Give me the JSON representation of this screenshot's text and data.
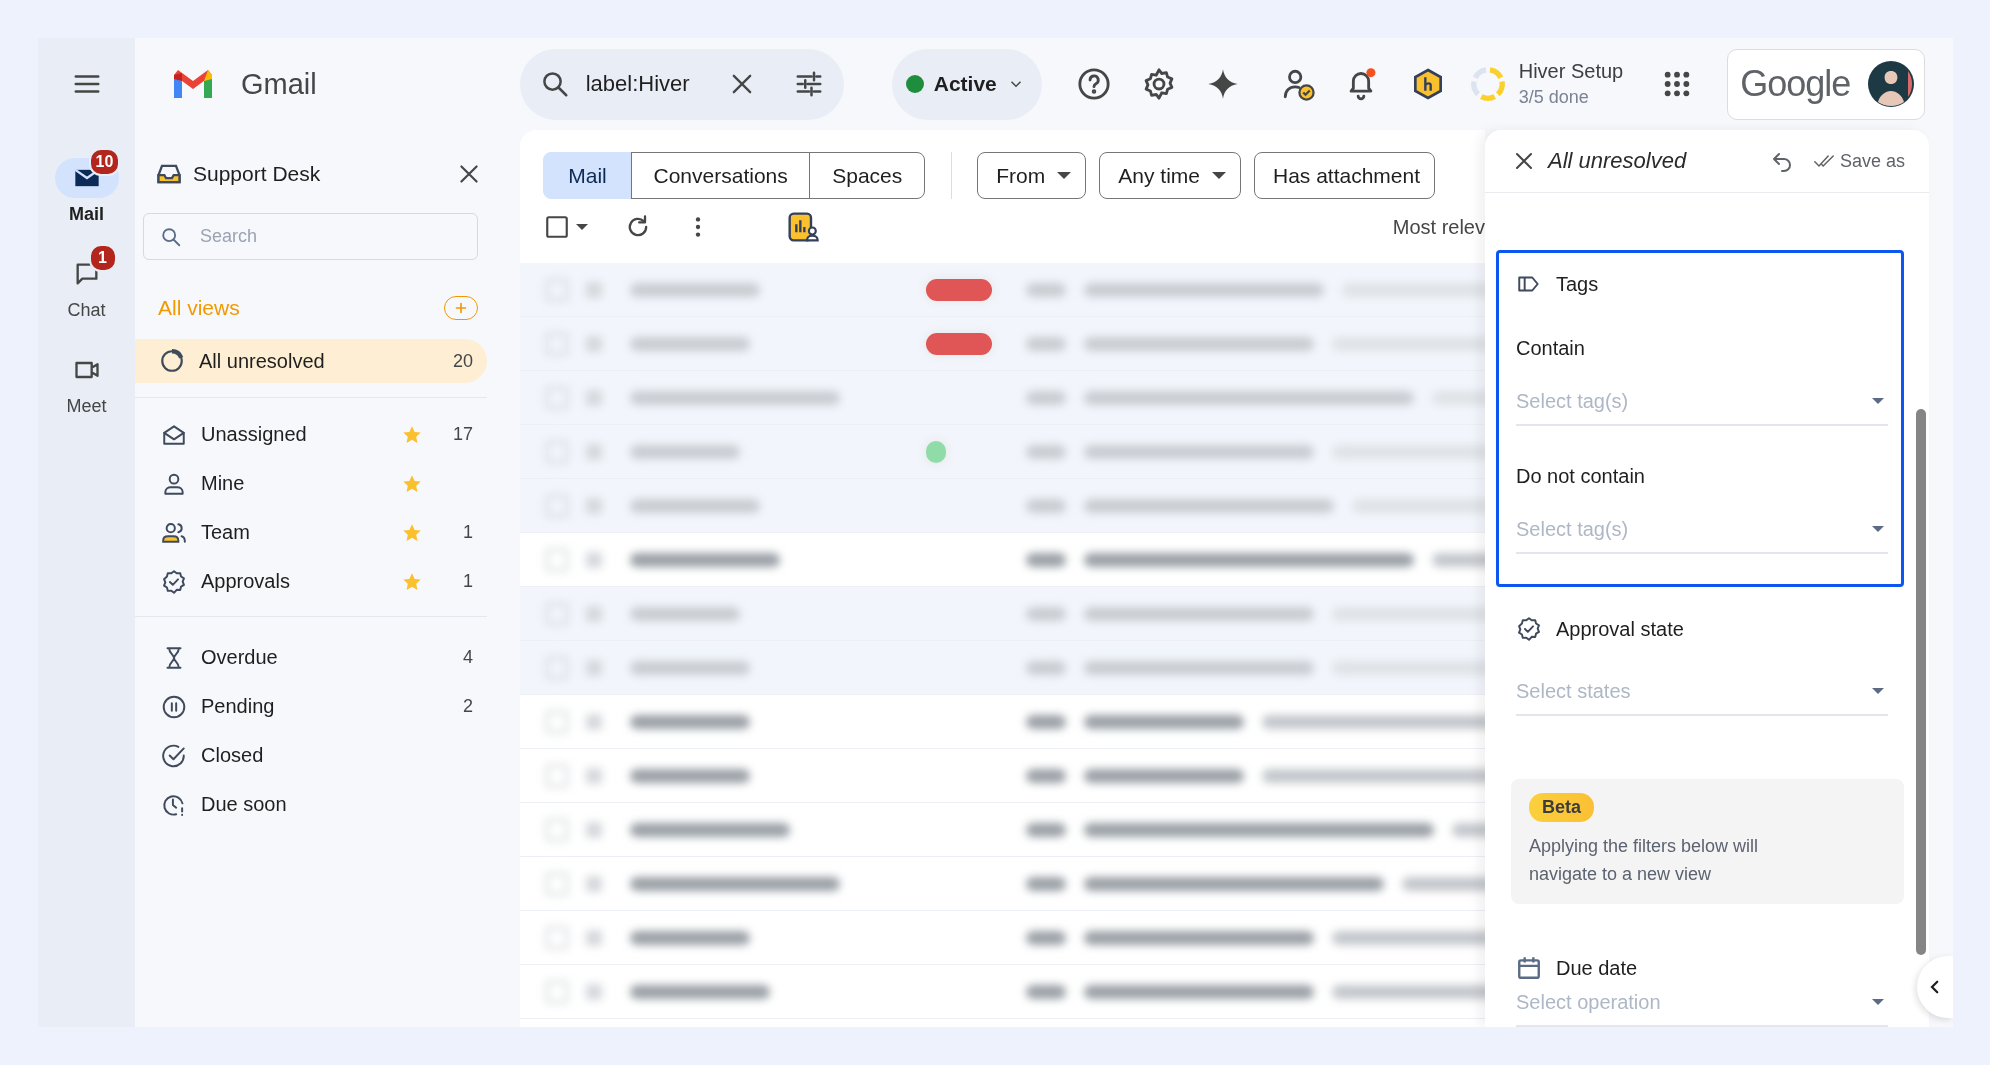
{
  "rail": {
    "items": [
      {
        "label": "Mail",
        "badge": "10",
        "selected": true
      },
      {
        "label": "Chat",
        "badge": "1",
        "selected": false
      },
      {
        "label": "Meet",
        "selected": false
      }
    ]
  },
  "topbar": {
    "app_name": "Gmail",
    "search": {
      "value": "label:Hiver"
    },
    "status": {
      "label": "Active",
      "online": true
    },
    "notifications": {
      "unread": true
    },
    "setup": {
      "title": "Hiver Setup",
      "progress": "3/5 done",
      "level": 0.6
    },
    "account": {
      "brand": "Google"
    }
  },
  "sidebar": {
    "title": "Support Desk",
    "search": {
      "placeholder": "Search"
    },
    "views_heading": "All views",
    "groups": [
      {
        "items": [
          {
            "label": "All unresolved",
            "count": "20",
            "starred": false,
            "selected": true
          }
        ]
      },
      {
        "items": [
          {
            "label": "Unassigned",
            "count": "17",
            "starred": true,
            "selected": false
          },
          {
            "label": "Mine",
            "starred": true,
            "selected": false
          },
          {
            "label": "Team",
            "count": "1",
            "starred": true,
            "selected": false
          },
          {
            "label": "Approvals",
            "count": "1",
            "starred": true,
            "selected": false
          }
        ]
      },
      {
        "items": [
          {
            "label": "Overdue",
            "count": "4",
            "starred": false,
            "selected": false
          },
          {
            "label": "Pending",
            "count": "2",
            "starred": false,
            "selected": false
          },
          {
            "label": "Closed",
            "starred": false,
            "selected": false
          },
          {
            "label": "Due soon",
            "starred": false,
            "selected": false
          }
        ]
      }
    ]
  },
  "mail": {
    "tabs": [
      {
        "label": "Mail",
        "selected": true
      },
      {
        "label": "Conversations",
        "selected": false
      },
      {
        "label": "Spaces",
        "selected": false
      }
    ],
    "filters": [
      {
        "label": "From",
        "dropdown": true
      },
      {
        "label": "Any time",
        "dropdown": true
      },
      {
        "label": "Has attachment",
        "dropdown": false
      }
    ],
    "select_all": {
      "checked": false
    },
    "sort_label": "Most relev",
    "rows": [
      {
        "unread": false,
        "color": "#e05555"
      },
      {
        "unread": false,
        "color": "#e05555"
      },
      {
        "unread": false
      },
      {
        "unread": false,
        "color": "#8fdca8"
      },
      {
        "unread": false
      },
      {
        "unread": true
      },
      {
        "unread": false
      },
      {
        "unread": false
      },
      {
        "unread": true
      },
      {
        "unread": true
      },
      {
        "unread": true
      },
      {
        "unread": true
      },
      {
        "unread": true
      },
      {
        "unread": true
      }
    ]
  },
  "filter_panel": {
    "title": "All unresolved",
    "save_label": "Save as",
    "sections": [
      {
        "kind": "tags",
        "label": "Tags",
        "highlighted": true,
        "fields": [
          {
            "label": "Contain",
            "placeholder": "Select tag(s)"
          },
          {
            "label": "Do not contain",
            "placeholder": "Select tag(s)"
          }
        ]
      },
      {
        "kind": "approval",
        "label": "Approval state",
        "highlighted": false,
        "fields": [
          {
            "placeholder": "Select states"
          }
        ]
      },
      {
        "kind": "notice",
        "badge": "Beta",
        "text": "Applying the filters below will navigate to a new view"
      },
      {
        "kind": "due",
        "label": "Due date",
        "highlighted": false,
        "fields": [
          {
            "placeholder": "Select operation"
          }
        ]
      }
    ]
  }
}
